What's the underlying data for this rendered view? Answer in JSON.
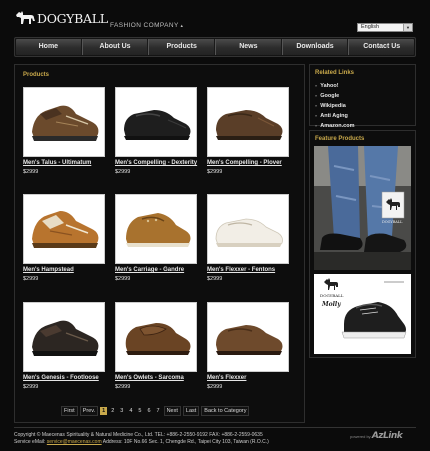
{
  "header": {
    "logo_text": "DOGYBALL",
    "tagline": "FASHION COMPANY",
    "language_selected": "English"
  },
  "nav": {
    "items": [
      "Home",
      "About Us",
      "Products",
      "News",
      "Downloads",
      "Contact Us"
    ]
  },
  "products": {
    "title": "Products",
    "items": [
      {
        "name": "Men's Talus - Ultimatum",
        "price": "$2999",
        "icon": "brown-sneaker"
      },
      {
        "name": "Men's Compelling - Dexterity",
        "price": "$2999",
        "icon": "black-loafer"
      },
      {
        "name": "Men's Compelling - Plover",
        "price": "$2999",
        "icon": "brown-loafer"
      },
      {
        "name": "Men's Hampstead",
        "price": "$2999",
        "icon": "tan-sneaker"
      },
      {
        "name": "Men's Carriage - Gandre",
        "price": "$2999",
        "icon": "tan-boat-shoe"
      },
      {
        "name": "Men's Flexxer - Fentons",
        "price": "$2999",
        "icon": "white-slip-on"
      },
      {
        "name": "Men's Genesis - Footloose",
        "price": "$2999",
        "icon": "dark-sneaker"
      },
      {
        "name": "Men's Owlets - Sarcoma",
        "price": "$2999",
        "icon": "brown-moccasin"
      },
      {
        "name": "Men's Flexxer",
        "price": "$2999",
        "icon": "brown-slip-on"
      }
    ]
  },
  "pager": {
    "first": "First",
    "prev": "Prev.",
    "pages": [
      "1",
      "2",
      "3",
      "4",
      "5",
      "6",
      "7"
    ],
    "current": "1",
    "next": "Next",
    "last": "Last",
    "back": "Back to Category"
  },
  "related": {
    "title": "Related Links",
    "links": [
      "Yahoo!",
      "Google",
      "Wikipedia",
      "Anti Aging",
      "Amazon.com"
    ]
  },
  "featured": {
    "title": "Feature Products",
    "banner1_logo": "DOGYBALL",
    "banner2_logo": "DOGYBALL",
    "banner2_caption": "Molly"
  },
  "footer": {
    "line1": "Copyright © Maecenas Spirituality & Natural Medicine Co., Ltd. TEL: +886-2-2550-9192 FAX: +886-2-2559-0635",
    "line2_prefix": "Service eMail:",
    "email": "service@maecenas.com",
    "line2_suffix": "Address: 10F No.66 Sec. 1, Chengde Rd., Taipei City 103, Taiwan (R.O.C.)",
    "powered_by": "powered by",
    "powered_brand": "AzLink"
  },
  "colors": {
    "accent": "#c9a94b",
    "background": "#0b0b0b",
    "panel_border": "#2e2e2e"
  }
}
